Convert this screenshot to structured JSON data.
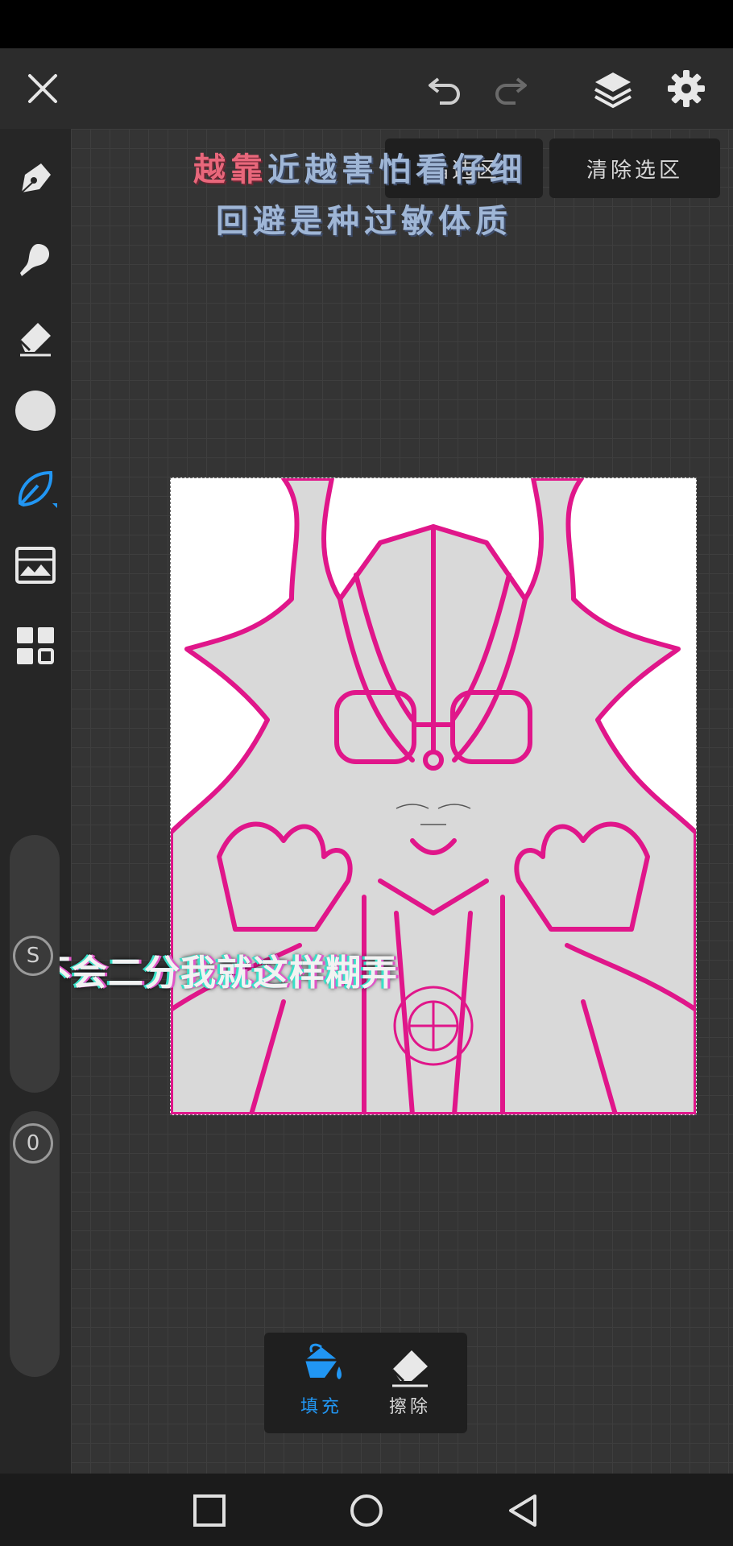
{
  "selection_actions": {
    "invert_label": "晶选区",
    "clear_label": "清除选区"
  },
  "lyrics": {
    "line1_highlight": "越靠",
    "line1_rest": "近越害怕看仔细",
    "line2": "回避是种过敏体质"
  },
  "subtitle": "不会二分我就这样糊弄",
  "brush_size": {
    "badge": "S"
  },
  "opacity": {
    "badge": "0"
  },
  "fill_panel": {
    "fill_label": "填充",
    "erase_label": "擦除"
  },
  "colors": {
    "accent": "#2196f3",
    "line_art": "#e0168a",
    "lyric_highlight": "#e8677b",
    "lyric_main": "#9fb6d6"
  },
  "icons": {
    "close": "close-icon",
    "undo": "undo-icon",
    "redo": "redo-icon",
    "layers": "layers-icon",
    "settings": "gear-icon",
    "pen": "pen-icon",
    "smudge": "smudge-icon",
    "eraser": "eraser-icon",
    "color": "color-circle-icon",
    "selection": "lasso-selection-icon",
    "adjust": "image-adjust-icon",
    "gallery": "grid-icon",
    "fill": "paint-bucket-icon"
  }
}
